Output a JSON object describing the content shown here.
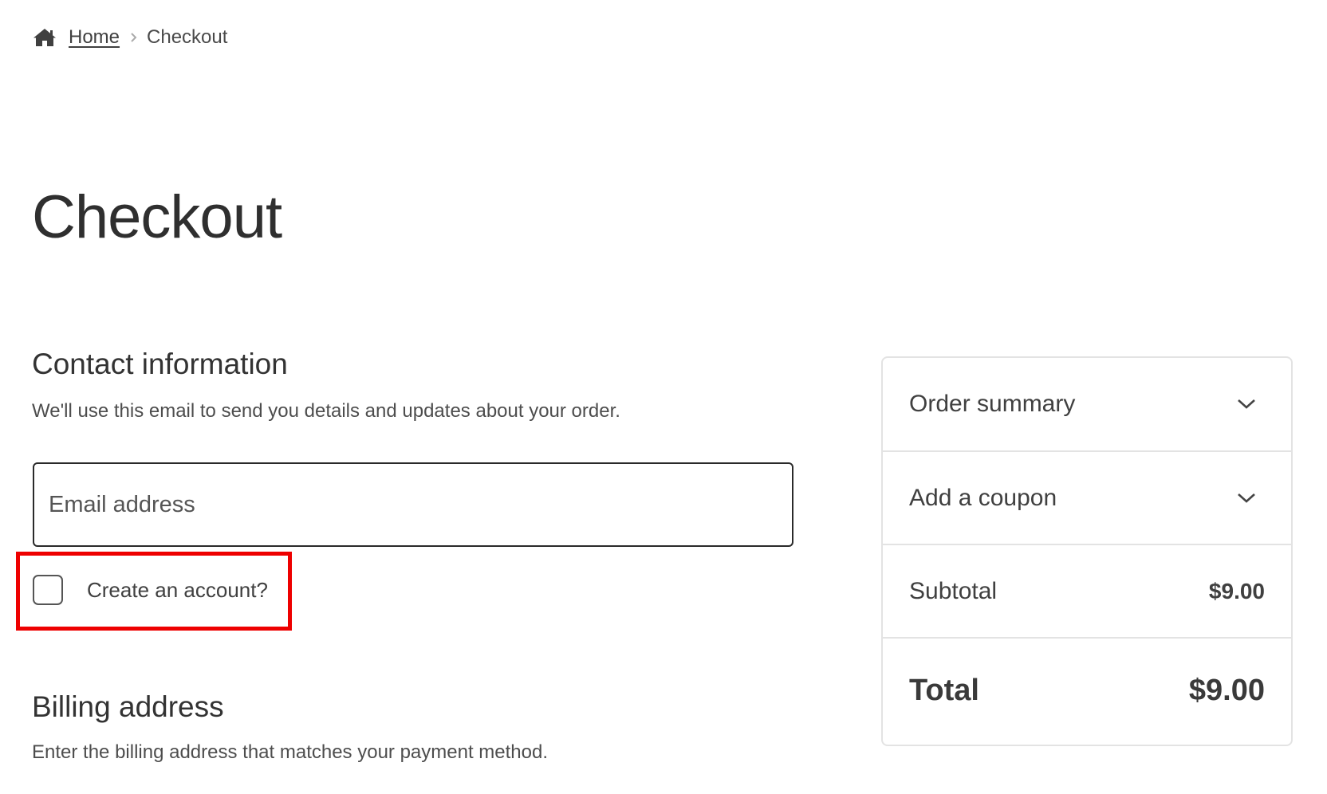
{
  "breadcrumb": {
    "home_label": "Home",
    "current_label": "Checkout"
  },
  "page": {
    "title": "Checkout"
  },
  "contact": {
    "title": "Contact information",
    "description": "We'll use this email to send you details and updates about your order.",
    "email_placeholder": "Email address",
    "email_value": "",
    "create_account_label": "Create an account?",
    "create_account_checked": false
  },
  "billing": {
    "title": "Billing address",
    "description": "Enter the billing address that matches your payment method."
  },
  "summary": {
    "order_summary_label": "Order summary",
    "coupon_label": "Add a coupon",
    "subtotal_label": "Subtotal",
    "subtotal_value": "$9.00",
    "total_label": "Total",
    "total_value": "$9.00"
  },
  "icons": {
    "home": "home-icon",
    "separator": "chevron-right-icon",
    "expand": "chevron-down-icon"
  },
  "colors": {
    "highlight": "#ee0000",
    "text": "#404040",
    "border": "#e3e3e3"
  }
}
